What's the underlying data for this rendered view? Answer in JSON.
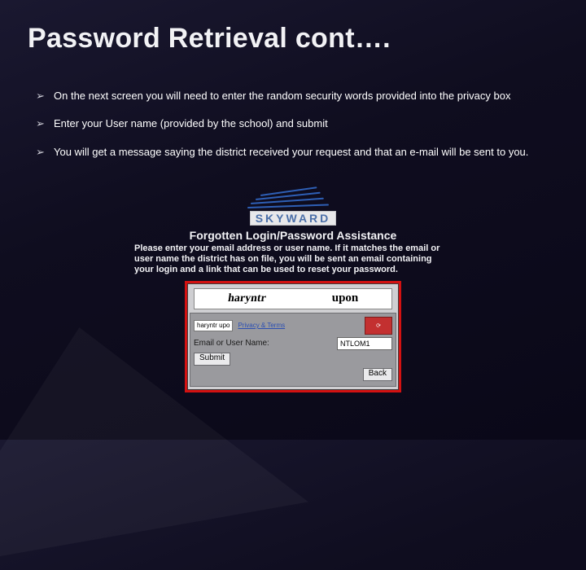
{
  "title": "Password Retrieval cont….",
  "bullets": [
    "On the next screen you will need to enter the random security words provided into the privacy box",
    "Enter your User name (provided by the school) and submit",
    "You will get a message saying the district received your request and that an e-mail will be sent to you."
  ],
  "logo_text": "SKYWARD",
  "subtitle": "Forgotten Login/Password Assistance",
  "instructions": "Please enter your email address or user name. If it matches the email or user name the district has on file, you will be sent an email containing your login and a link that can be used to reset your password.",
  "captcha": {
    "word1": "haryntr",
    "word2": "upon"
  },
  "form": {
    "privacy_input": "haryntr upo",
    "privacy_link": "Privacy & Terms",
    "email_label": "Email or User Name:",
    "email_value": "NTLOM1",
    "submit": "Submit",
    "back": "Back"
  }
}
